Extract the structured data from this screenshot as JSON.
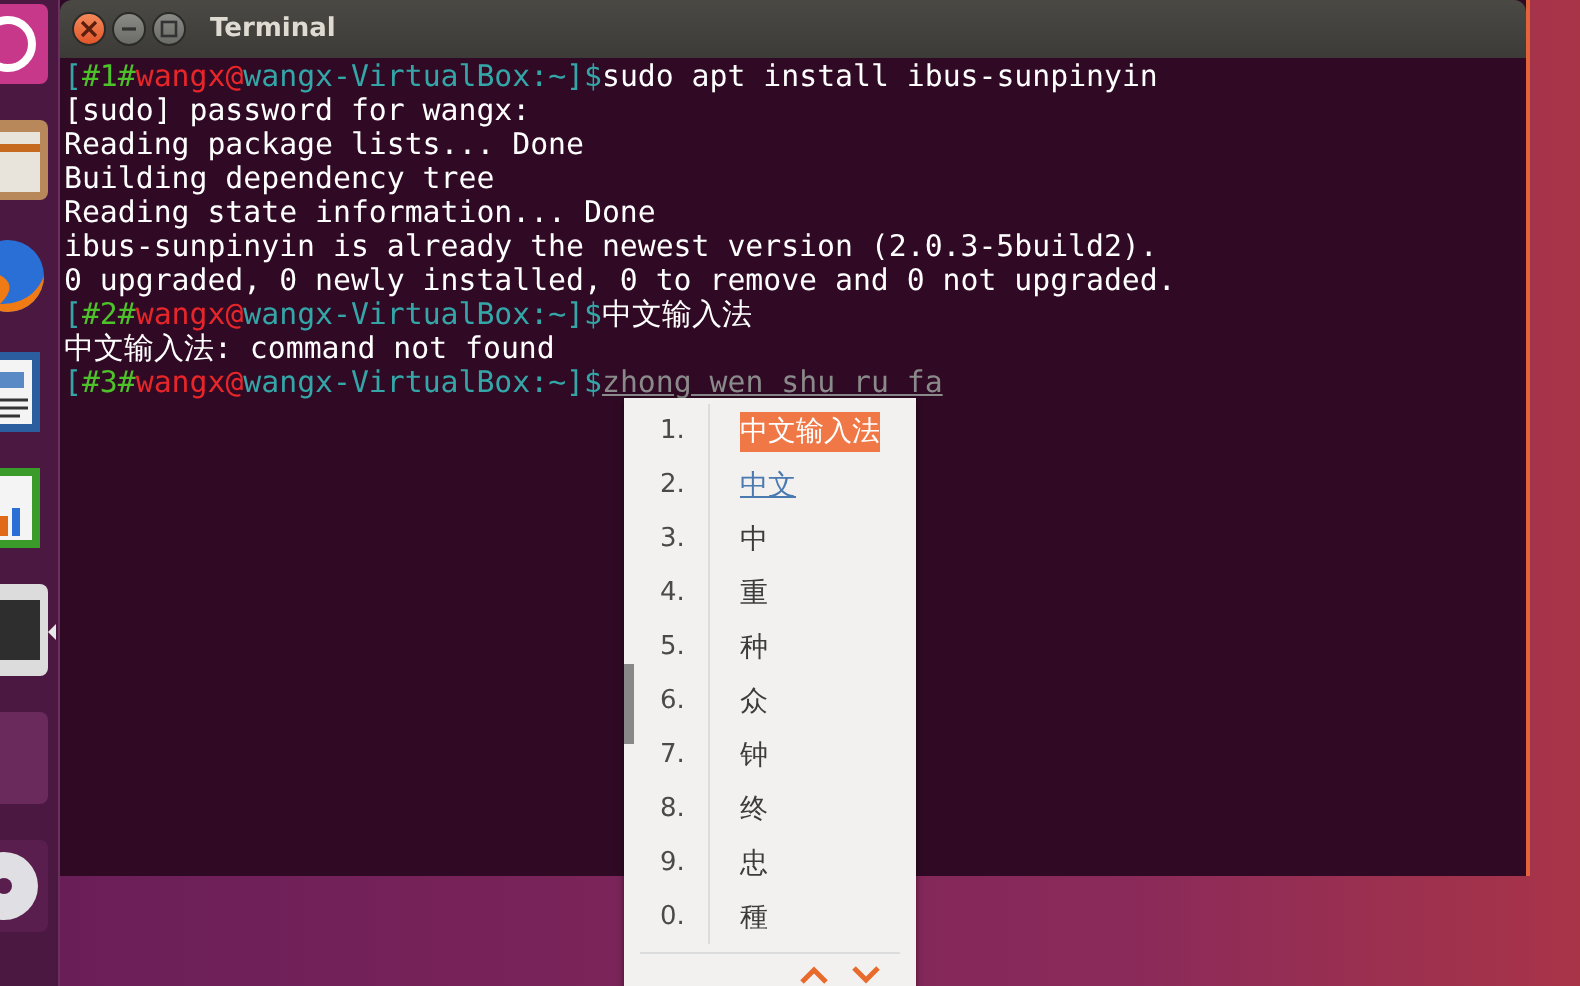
{
  "window": {
    "title": "Terminal"
  },
  "launcher": [
    {
      "kind": "ubuntu",
      "selected": false
    },
    {
      "kind": "files",
      "selected": false
    },
    {
      "kind": "browser",
      "selected": false
    },
    {
      "kind": "writer",
      "selected": false
    },
    {
      "kind": "calc",
      "selected": false
    },
    {
      "kind": "terminal",
      "selected": true
    },
    {
      "kind": "blank",
      "selected": false
    },
    {
      "kind": "disc",
      "selected": false
    }
  ],
  "lines": [
    {
      "kind": "prompt",
      "open": "[",
      "tag": "#1#",
      "user": "wangx@",
      "host": "wangx-VirtualBox:~",
      "close": "]$",
      "command": "sudo apt install ibus-sunpinyin",
      "composing": false
    },
    {
      "kind": "output",
      "text": "[sudo] password for wangx:"
    },
    {
      "kind": "output",
      "text": "Reading package lists... Done"
    },
    {
      "kind": "output",
      "text": "Building dependency tree"
    },
    {
      "kind": "output",
      "text": "Reading state information... Done"
    },
    {
      "kind": "output",
      "text": "ibus-sunpinyin is already the newest version (2.0.3-5build2)."
    },
    {
      "kind": "output",
      "text": "0 upgraded, 0 newly installed, 0 to remove and 0 not upgraded."
    },
    {
      "kind": "prompt",
      "open": "[",
      "tag": "#2#",
      "user": "wangx@",
      "host": "wangx-VirtualBox:~",
      "close": "]$",
      "command": "中文输入法",
      "composing": false
    },
    {
      "kind": "output",
      "text": "中文输入法: command not found"
    },
    {
      "kind": "prompt",
      "open": "[",
      "tag": "#3#",
      "user": "wangx@",
      "host": "wangx-VirtualBox:~",
      "close": "]$",
      "command": "zhong wen shu ru fa",
      "composing": true
    }
  ],
  "candidates": [
    {
      "number": "1.",
      "text": "中文输入法",
      "selected": true,
      "hovered": false
    },
    {
      "number": "2.",
      "text": "中文",
      "selected": false,
      "hovered": true
    },
    {
      "number": "3.",
      "text": "中",
      "selected": false,
      "hovered": false
    },
    {
      "number": "4.",
      "text": "重",
      "selected": false,
      "hovered": false
    },
    {
      "number": "5.",
      "text": "种",
      "selected": false,
      "hovered": false
    },
    {
      "number": "6.",
      "text": "众",
      "selected": false,
      "hovered": false
    },
    {
      "number": "7.",
      "text": "钟",
      "selected": false,
      "hovered": false
    },
    {
      "number": "8.",
      "text": "终",
      "selected": false,
      "hovered": false
    },
    {
      "number": "9.",
      "text": "忠",
      "selected": false,
      "hovered": false
    },
    {
      "number": "0.",
      "text": "種",
      "selected": false,
      "hovered": false
    }
  ]
}
